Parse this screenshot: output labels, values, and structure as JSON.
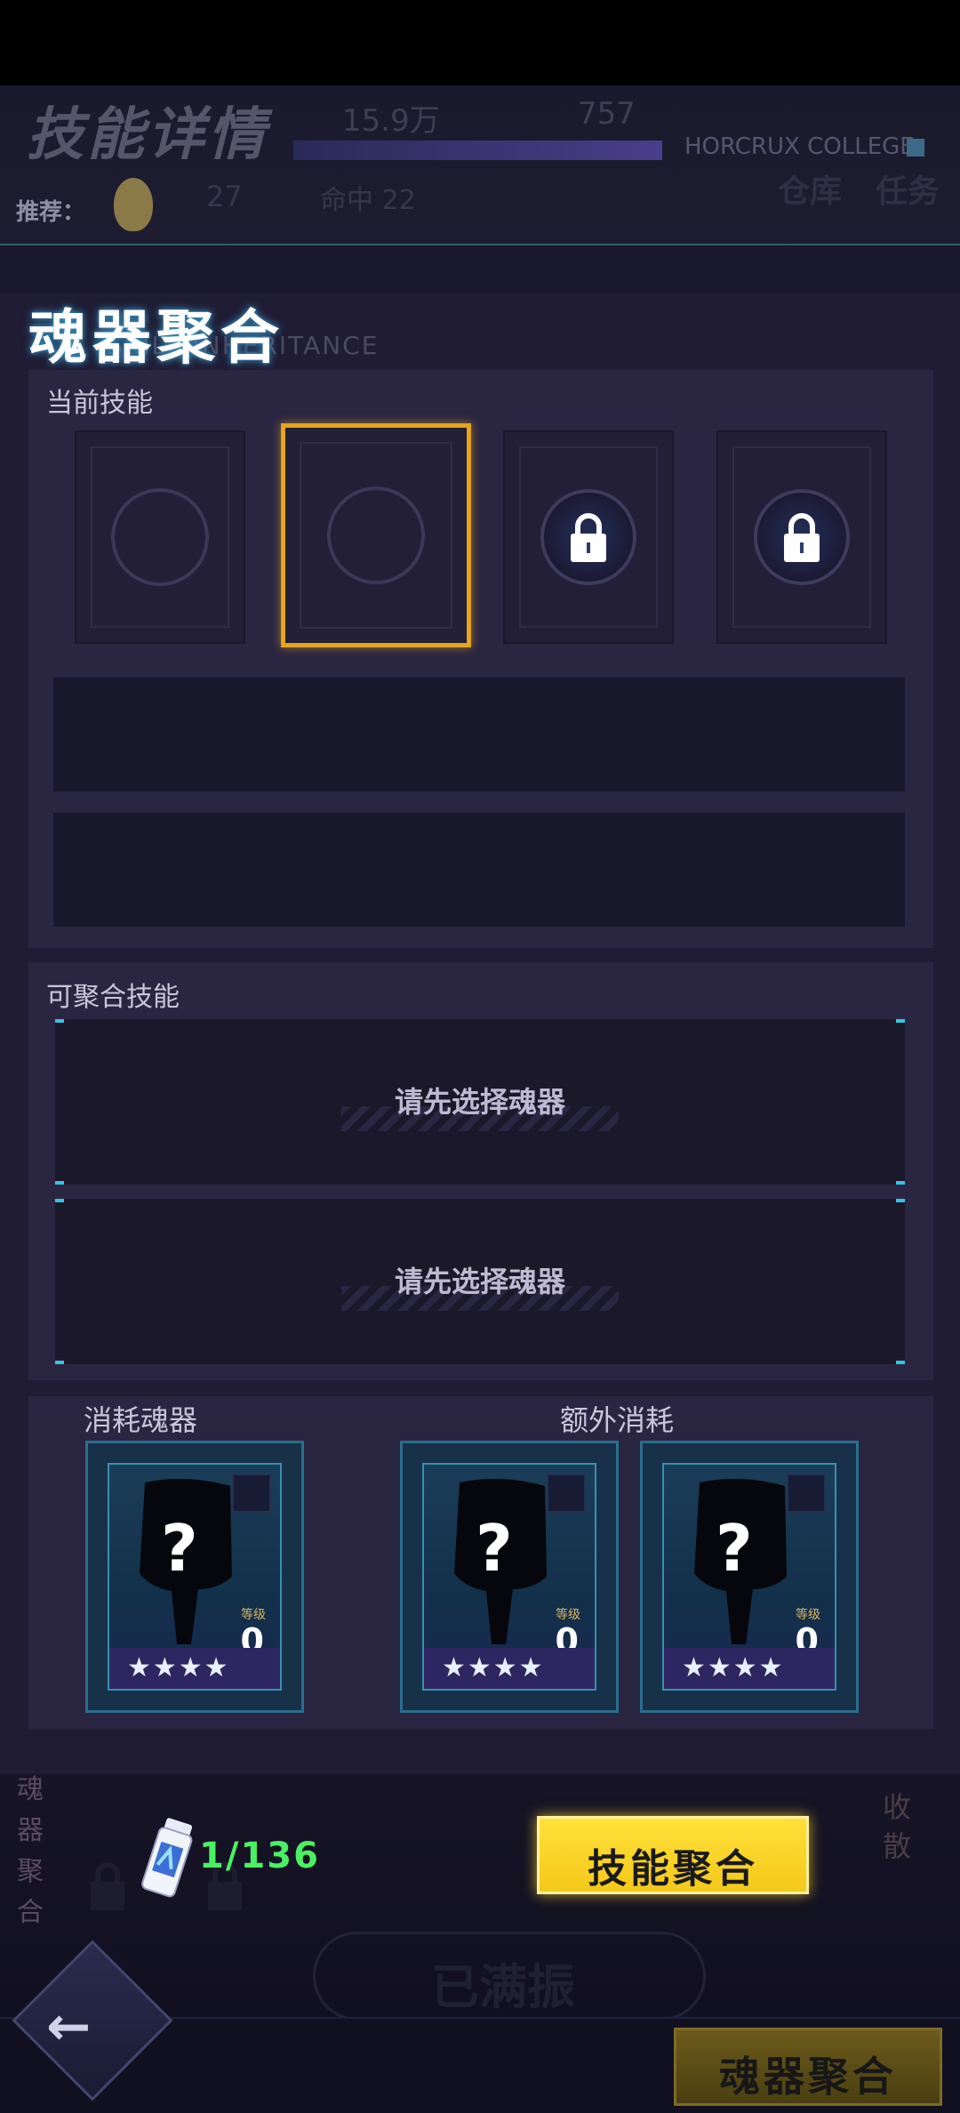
{
  "background": {
    "title": "技能详情",
    "resource_1": "15.9万",
    "resource_2": "757",
    "college": "HORCRUX COLLEGE",
    "recommend_label": "推荐：",
    "level": "27",
    "hit_label": "命中 22",
    "warehouse": "仓库",
    "task": "任务",
    "full_button": "已满振",
    "side_label": "魂器聚合",
    "scatter_label": "收散"
  },
  "panel": {
    "title": "魂器聚合",
    "subtitle": "SKILL INHERITANCE"
  },
  "current_skill": {
    "label": "当前技能",
    "slots": [
      {
        "state": "empty"
      },
      {
        "state": "selected"
      },
      {
        "state": "locked",
        "icon": "lock-icon"
      },
      {
        "state": "locked",
        "icon": "lock-icon"
      }
    ]
  },
  "fusible_skill": {
    "label": "可聚合技能",
    "placeholders": [
      "请先选择魂器",
      "请先选择魂器"
    ]
  },
  "consume": {
    "consume_label": "消耗魂器",
    "extra_label": "额外消耗",
    "cards": [
      {
        "mark": "?",
        "level_label": "等级",
        "level": "0",
        "stars": "★★★★"
      },
      {
        "mark": "?",
        "level_label": "等级",
        "level": "0",
        "stars": "★★★★"
      },
      {
        "mark": "?",
        "level_label": "等级",
        "level": "0",
        "stars": "★★★★"
      }
    ]
  },
  "footer": {
    "potion_icon": "potion-icon",
    "count": "1/136",
    "fuse_button": "技能聚合",
    "back_icon": "back-arrow-icon",
    "bottom_tab": "魂器聚合"
  },
  "colors": {
    "accent_yellow": "#f4c81a",
    "count_green": "#4bef63",
    "selected_border": "#e4a51f",
    "cyan_accent": "#36c4e6"
  }
}
